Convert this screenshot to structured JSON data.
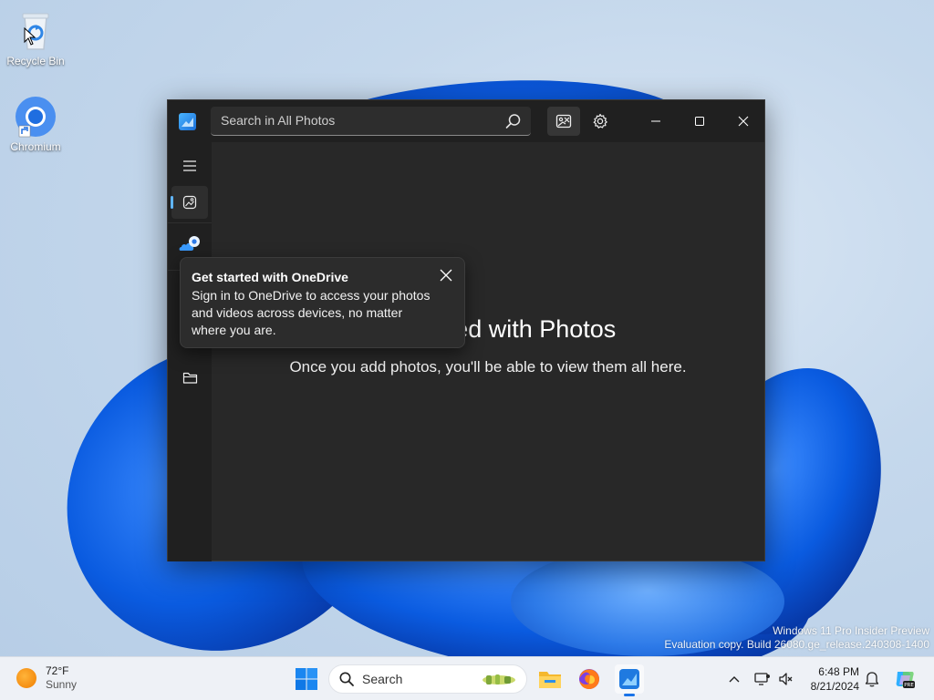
{
  "desktop": {
    "icons": [
      {
        "label": "Recycle Bin",
        "icon": "recycle-bin-icon"
      },
      {
        "label": "Chromium",
        "icon": "chromium-icon"
      }
    ]
  },
  "window": {
    "app_icon": "photos-app-icon",
    "search": {
      "placeholder": "Search in All Photos",
      "value": ""
    },
    "titlebar_buttons": [
      {
        "name": "image-compare-icon"
      },
      {
        "name": "gear-icon"
      }
    ],
    "controls": [
      "minimize-icon",
      "maximize-icon",
      "close-icon"
    ],
    "sidebar": {
      "items": [
        {
          "name": "hamburger-menu-icon"
        },
        {
          "name": "all-photos-icon",
          "selected": true
        },
        {
          "name": "onedrive-icon"
        },
        {
          "name": "folder-icon"
        }
      ]
    },
    "empty_state": {
      "title": "Get started with Photos",
      "subtitle": "Once you add photos, you'll be able to view them all here."
    },
    "teaching_tip": {
      "title": "Get started with OneDrive",
      "body": "Sign in to OneDrive to access your photos and videos across devices, no matter where you are."
    }
  },
  "watermark": {
    "line1": "Windows 11 Pro Insider Preview",
    "line2": "Evaluation copy. Build 26080.ge_release.240308-1400"
  },
  "taskbar": {
    "weather": {
      "temp": "72°F",
      "condition": "Sunny"
    },
    "search_label": "Search",
    "apps": [
      "file-explorer-icon",
      "firefox-icon",
      "photos-app-icon"
    ],
    "clock": {
      "time": "6:48 PM",
      "date": "8/21/2024"
    },
    "colors": {
      "accent": "#1a73e8",
      "nav_indicator": "#60b5ff"
    }
  }
}
